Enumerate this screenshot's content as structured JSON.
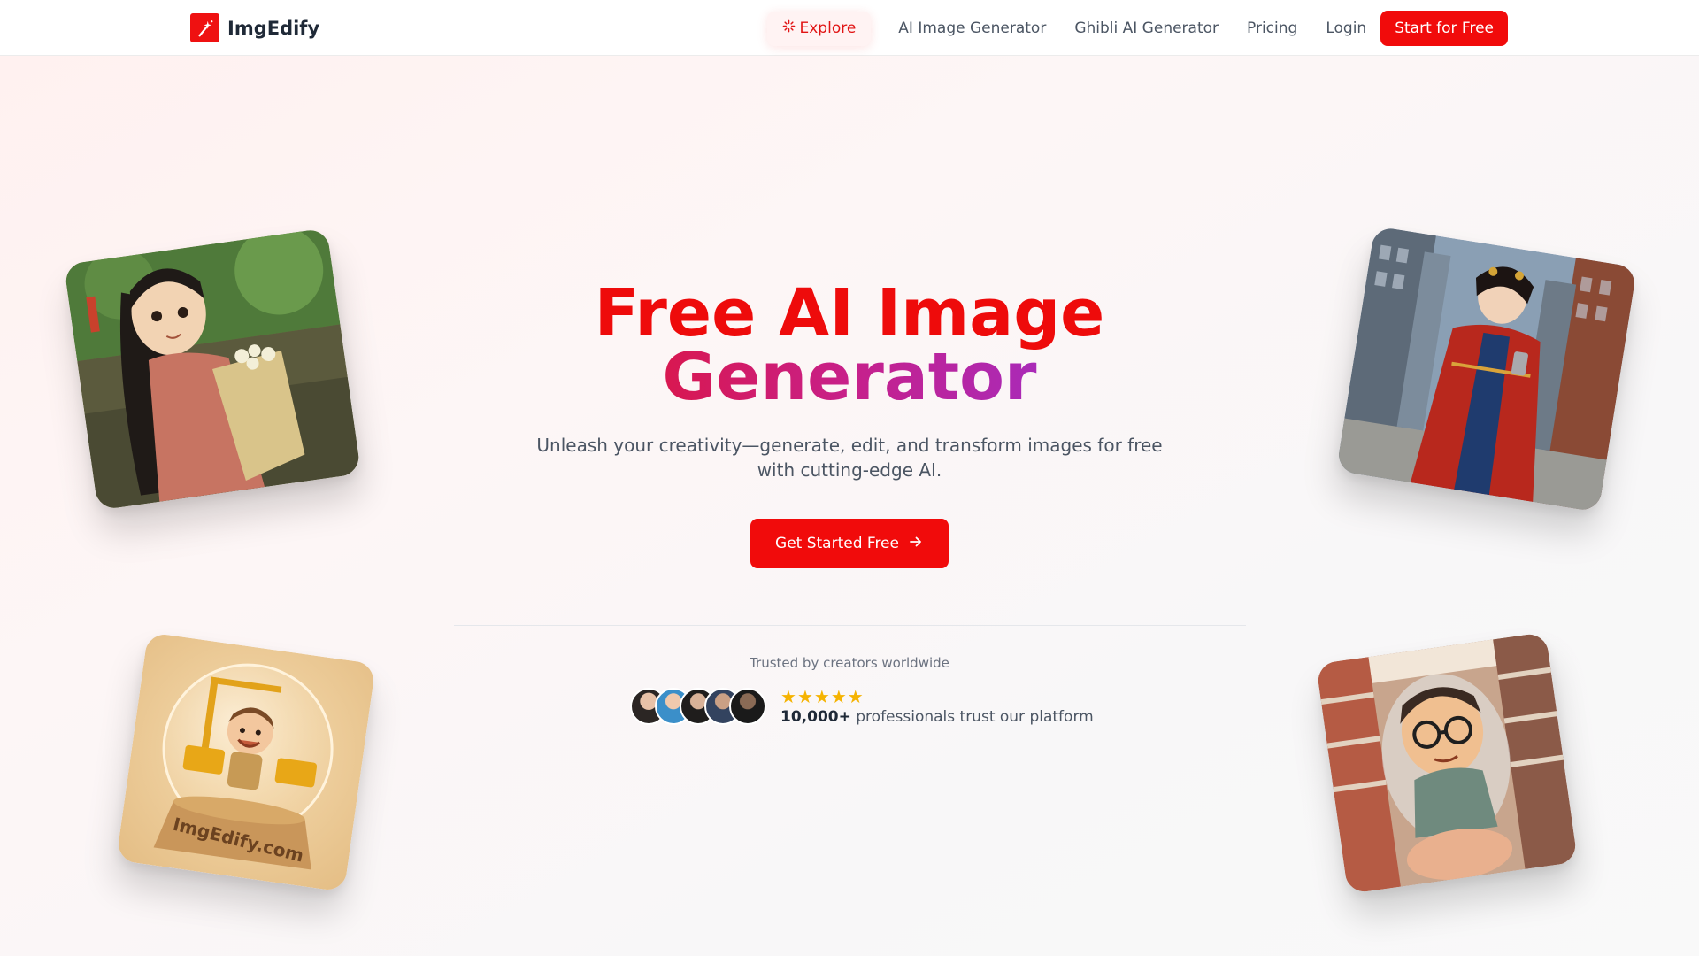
{
  "header": {
    "logo_text": "ImgEdify",
    "nav": {
      "explore": "Explore",
      "ai_image_generator": "AI Image Generator",
      "ghibli_ai_generator": "Ghibli AI Generator",
      "pricing": "Pricing",
      "login": "Login",
      "cta": "Start for Free"
    }
  },
  "hero": {
    "title_line1": "Free AI Image",
    "title_line2": "Generator",
    "subtitle": "Unleash your creativity—generate, edit, and transform images for free with cutting-edge AI.",
    "cta": "Get Started Free"
  },
  "social_proof": {
    "label": "Trusted by creators worldwide",
    "rating_stars": 5,
    "count": "10,000+",
    "text": "professionals trust our platform"
  },
  "gallery": {
    "snow_globe_text": "ImgEdify.com"
  },
  "colors": {
    "brand_red": "#f10b0b",
    "gradient_start": "#e8101c",
    "gradient_end": "#8f33e0",
    "star_gold": "#f5b301"
  }
}
